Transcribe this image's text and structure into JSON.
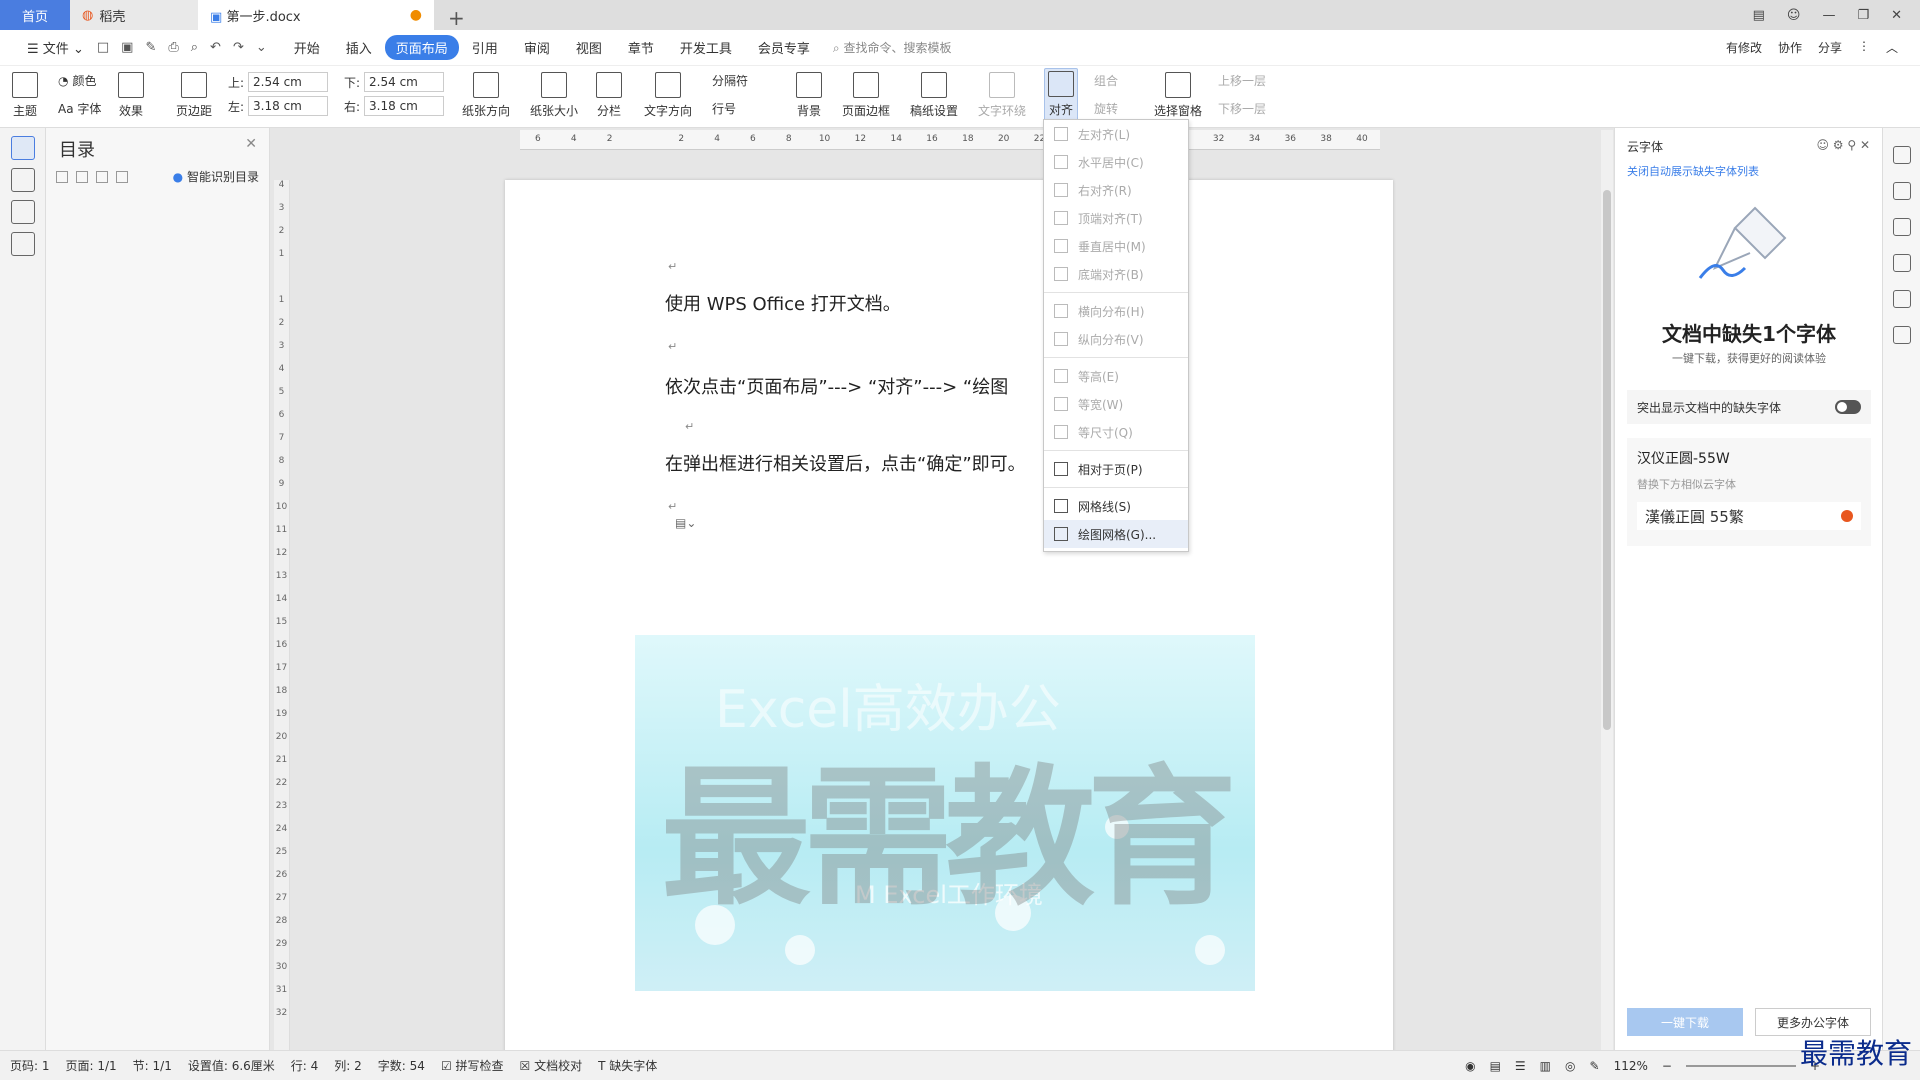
{
  "titlebar": {
    "tab_home": "首页",
    "tab_daoke": "稻壳",
    "tab_doc": "第一步.docx"
  },
  "menu": {
    "file": "文件",
    "items": [
      "开始",
      "插入",
      "页面布局",
      "引用",
      "审阅",
      "视图",
      "章节",
      "开发工具",
      "会员专享"
    ],
    "search": "查找命令、搜索模板",
    "right": [
      "有修改",
      "协作",
      "分享"
    ]
  },
  "ribbon": {
    "theme": "主题",
    "color": "颜色",
    "font": "Aa 字体",
    "effect": "效果",
    "margin": "页边距",
    "top_l": "上:",
    "top_v": "2.54 cm",
    "bottom_l": "下:",
    "bottom_v": "2.54 cm",
    "left_l": "左:",
    "left_v": "3.18 cm",
    "right_l": "右:",
    "right_v": "3.18 cm",
    "orient": "纸张方向",
    "size": "纸张大小",
    "columns": "分栏",
    "textdir": "文字方向",
    "sep": "分隔符",
    "lineno": "行号",
    "bg": "背景",
    "border": "页面边框",
    "grid": "稿纸设置",
    "wrap": "文字环绕",
    "align": "对齐",
    "group": "组合",
    "rotate": "旋转",
    "selpane": "选择窗格",
    "up": "上移一层",
    "down": "下移一层"
  },
  "toc": {
    "title": "目录",
    "smart": "智能识别目录"
  },
  "ruler": {
    "h": [
      "6",
      "4",
      "2",
      "",
      "2",
      "4",
      "6",
      "8",
      "10",
      "12",
      "14",
      "16",
      "18",
      "20",
      "22",
      "24",
      "26",
      "28",
      "30",
      "32",
      "34",
      "36",
      "38",
      "40"
    ],
    "v": [
      "4",
      "3",
      "2",
      "1",
      "",
      "1",
      "2",
      "3",
      "4",
      "5",
      "6",
      "7",
      "8",
      "9",
      "10",
      "11",
      "12",
      "13",
      "14",
      "15",
      "16",
      "17",
      "18",
      "19",
      "20",
      "21",
      "22",
      "23",
      "24",
      "25",
      "26",
      "27",
      "28",
      "29",
      "30",
      "31",
      "32"
    ]
  },
  "document": {
    "p1": "使用 WPS Office 打开文档。",
    "p2": "依次点击“页面布局”---> “对齐”---> “绘图",
    "p3": "在弹出框进行相关设置后，点击“确定”即可。",
    "ret": "↵",
    "image": {
      "t1": "Excel高效办公",
      "t2": "M Excel工作环境",
      "watermark": "最需教育"
    }
  },
  "dropdown": {
    "items": [
      {
        "label": "左对齐(L)",
        "enabled": false
      },
      {
        "label": "水平居中(C)",
        "enabled": false
      },
      {
        "label": "右对齐(R)",
        "enabled": false
      },
      {
        "label": "顶端对齐(T)",
        "enabled": false
      },
      {
        "label": "垂直居中(M)",
        "enabled": false
      },
      {
        "label": "底端对齐(B)",
        "enabled": false
      },
      {
        "label": "横向分布(H)",
        "enabled": false
      },
      {
        "label": "纵向分布(V)",
        "enabled": false
      },
      {
        "label": "等高(E)",
        "enabled": false
      },
      {
        "label": "等宽(W)",
        "enabled": false
      },
      {
        "label": "等尺寸(Q)",
        "enabled": false
      },
      {
        "label": "相对于页(P)",
        "enabled": true
      },
      {
        "label": "网格线(S)",
        "enabled": true
      },
      {
        "label": "绘图网格(G)...",
        "enabled": true
      }
    ]
  },
  "panel": {
    "header": "云字体",
    "link": "关闭自动展示缺失字体列表",
    "title": "文档中缺失1个字体",
    "sub": "一键下载，获得更好的阅读体验",
    "toggle": "突出显示文档中的缺失字体",
    "font_name": "汉仪正圆-55W",
    "font_hint": "替换下方相似云字体",
    "font_sample": "漢儀正圓 55繁",
    "btn_download": "一键下载",
    "btn_more": "更多办公字体"
  },
  "status": {
    "page": "页码: 1",
    "pages": "页面: 1/1",
    "section": "节: 1/1",
    "setting": "设置值: 6.6厘米",
    "row": "行: 4",
    "col": "列: 2",
    "words": "字数: 54",
    "spell": "拼写检查",
    "proof": "文档校对",
    "missing": "缺失字体",
    "zoom": "112%"
  },
  "watermark_logo": "最需教育"
}
